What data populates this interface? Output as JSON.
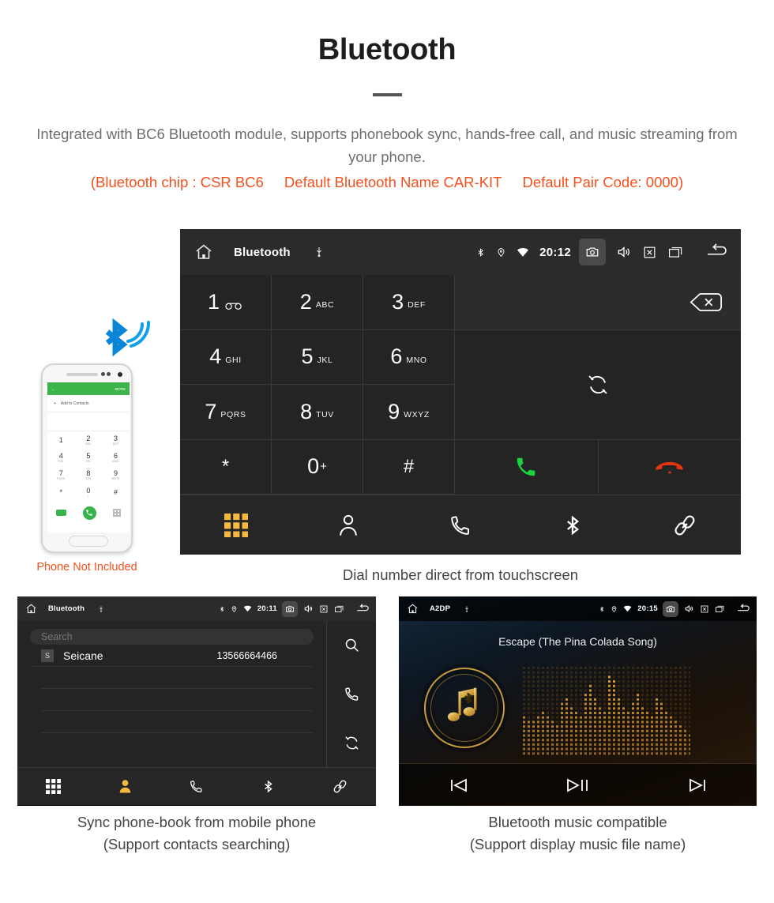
{
  "header": {
    "title": "Bluetooth",
    "description": "Integrated with BC6 Bluetooth module, supports phonebook sync, hands-free call, and music streaming from your phone.",
    "spec_chip": "(Bluetooth chip : CSR BC6",
    "spec_name": "Default Bluetooth Name CAR-KIT",
    "spec_pair": "Default Pair Code: 0000)",
    "accent_color": "#f4511e",
    "body_color": "#6e6e6e"
  },
  "dialer": {
    "statusbar": {
      "home_icon": "home-icon",
      "title": "Bluetooth",
      "usb_icon": "usb-icon",
      "bluetooth_icon": "bluetooth-icon",
      "location_icon": "location-icon",
      "wifi_icon": "wifi-icon",
      "time": "20:12",
      "camera_icon": "camera-icon",
      "volume_icon": "volume-icon",
      "close_icon": "close-box-icon",
      "recents_icon": "recent-apps-icon",
      "back_icon": "back-icon"
    },
    "keys": [
      {
        "num": "1",
        "sub": "",
        "glyph": "voicemail"
      },
      {
        "num": "2",
        "sub": "ABC",
        "glyph": ""
      },
      {
        "num": "3",
        "sub": "DEF",
        "glyph": ""
      },
      {
        "num": "4",
        "sub": "GHI",
        "glyph": ""
      },
      {
        "num": "5",
        "sub": "JKL",
        "glyph": ""
      },
      {
        "num": "6",
        "sub": "MNO",
        "glyph": ""
      },
      {
        "num": "7",
        "sub": "PQRS",
        "glyph": ""
      },
      {
        "num": "8",
        "sub": "TUV",
        "glyph": ""
      },
      {
        "num": "9",
        "sub": "WXYZ",
        "glyph": ""
      },
      {
        "num": "*",
        "sub": "",
        "glyph": ""
      },
      {
        "num": "0",
        "sub": "",
        "glyph": "plus"
      },
      {
        "num": "#",
        "sub": "",
        "glyph": ""
      }
    ],
    "display_value": "",
    "backspace_icon": "backspace-icon",
    "sync_icon": "sync-icon",
    "call_icon": "call-answer-icon",
    "hangup_icon": "call-end-icon",
    "tabs": [
      {
        "name": "dialpad",
        "icon": "dialpad-icon",
        "active": true
      },
      {
        "name": "contacts",
        "icon": "person-icon",
        "active": false
      },
      {
        "name": "call-log",
        "icon": "phone-icon",
        "active": false
      },
      {
        "name": "bluetooth",
        "icon": "bluetooth-icon",
        "active": false
      },
      {
        "name": "pair-link",
        "icon": "link-icon",
        "active": false
      }
    ],
    "active_tab_color": "#f5b942",
    "caption": "Dial number direct from touchscreen"
  },
  "phone_mock": {
    "appbar_back_icon": "back-arrow-icon",
    "appbar_more_label": "MORE",
    "add_contact_label": "Add to Contacts",
    "keys": [
      {
        "n": "1",
        "s": ""
      },
      {
        "n": "2",
        "s": "ABC"
      },
      {
        "n": "3",
        "s": "DEF"
      },
      {
        "n": "4",
        "s": "GHI"
      },
      {
        "n": "5",
        "s": "JKL"
      },
      {
        "n": "6",
        "s": "MNO"
      },
      {
        "n": "7",
        "s": "PQRS"
      },
      {
        "n": "8",
        "s": "TUV"
      },
      {
        "n": "9",
        "s": "WXYZ"
      },
      {
        "n": "*",
        "s": ""
      },
      {
        "n": "0",
        "s": "+"
      },
      {
        "n": "#",
        "s": ""
      }
    ],
    "video_call_icon": "video-call-icon",
    "call_icon": "call-icon",
    "keypad_toggle_icon": "keypad-icon",
    "bluetooth_logo_icon": "bluetooth-signal-icon",
    "note": "Phone Not Included",
    "note_color": "#f4511e"
  },
  "phonebook": {
    "statusbar": {
      "home_icon": "home-icon",
      "title": "Bluetooth",
      "usb_icon": "usb-icon",
      "time": "20:11",
      "camera_icon": "camera-icon",
      "volume_icon": "volume-icon",
      "close_icon": "close-box-icon",
      "recents_icon": "recent-apps-icon",
      "back_icon": "back-icon"
    },
    "search_placeholder": "Search",
    "search_value": "",
    "contacts": [
      {
        "initial": "S",
        "name": "Seicane",
        "number": "13566664466"
      }
    ],
    "side_icons": [
      {
        "name": "search-icon"
      },
      {
        "name": "phone-icon"
      },
      {
        "name": "sync-icon"
      }
    ],
    "tabs": [
      {
        "name": "dialpad",
        "icon": "dialpad-icon",
        "active": false
      },
      {
        "name": "contacts",
        "icon": "person-icon",
        "active": true
      },
      {
        "name": "call-log",
        "icon": "phone-icon",
        "active": false
      },
      {
        "name": "bluetooth",
        "icon": "bluetooth-icon",
        "active": false
      },
      {
        "name": "pair-link",
        "icon": "link-icon",
        "active": false
      }
    ],
    "caption_line1": "Sync phone-book from mobile phone",
    "caption_line2": "(Support contacts searching)"
  },
  "music": {
    "statusbar": {
      "home_icon": "home-icon",
      "title": "A2DP",
      "usb_icon": "usb-icon",
      "time": "20:15",
      "camera_icon": "camera-icon",
      "volume_icon": "volume-icon",
      "close_icon": "close-box-icon",
      "recents_icon": "recent-apps-icon",
      "back_icon": "back-icon"
    },
    "track_title": "Escape (The Pina Colada Song)",
    "album_art_icon": "music-note-bluetooth-icon",
    "visualizer": "dot-matrix-spectrum",
    "controls": [
      {
        "name": "previous-track",
        "icon": "skip-previous-icon"
      },
      {
        "name": "play-pause",
        "icon": "play-pause-icon"
      },
      {
        "name": "next-track",
        "icon": "skip-next-icon"
      }
    ],
    "accent_color": "#c79a3c",
    "caption_line1": "Bluetooth music compatible",
    "caption_line2": "(Support display music file name)"
  }
}
